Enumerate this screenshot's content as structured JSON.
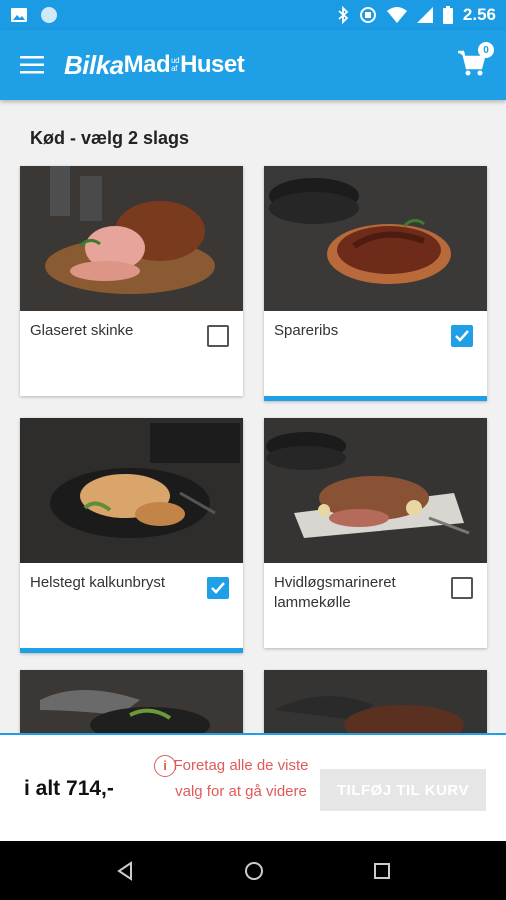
{
  "status_bar": {
    "time": "2.56"
  },
  "app_bar": {
    "logo_bilka": "Bilka",
    "logo_mad": "Mad",
    "logo_af": "ud",
    "logo_af2": "af",
    "logo_huset": "Huset",
    "cart_count": "0"
  },
  "section": {
    "title": "Kød - vælg 2 slags"
  },
  "products": [
    {
      "name": "Glaseret skinke",
      "checked": false
    },
    {
      "name": "Spareribs",
      "checked": true
    },
    {
      "name": "Helstegt kalkunbryst",
      "checked": true
    },
    {
      "name": "Hvidløgsmarineret lammekølle",
      "checked": false
    }
  ],
  "footer": {
    "total": "i alt 714,-",
    "warning": "Foretag alle de viste valg for at gå videre",
    "add_button": "TILFØJ TIL KURV"
  },
  "colors": {
    "accent": "#1e9fe6",
    "warning": "#e05a5a"
  }
}
